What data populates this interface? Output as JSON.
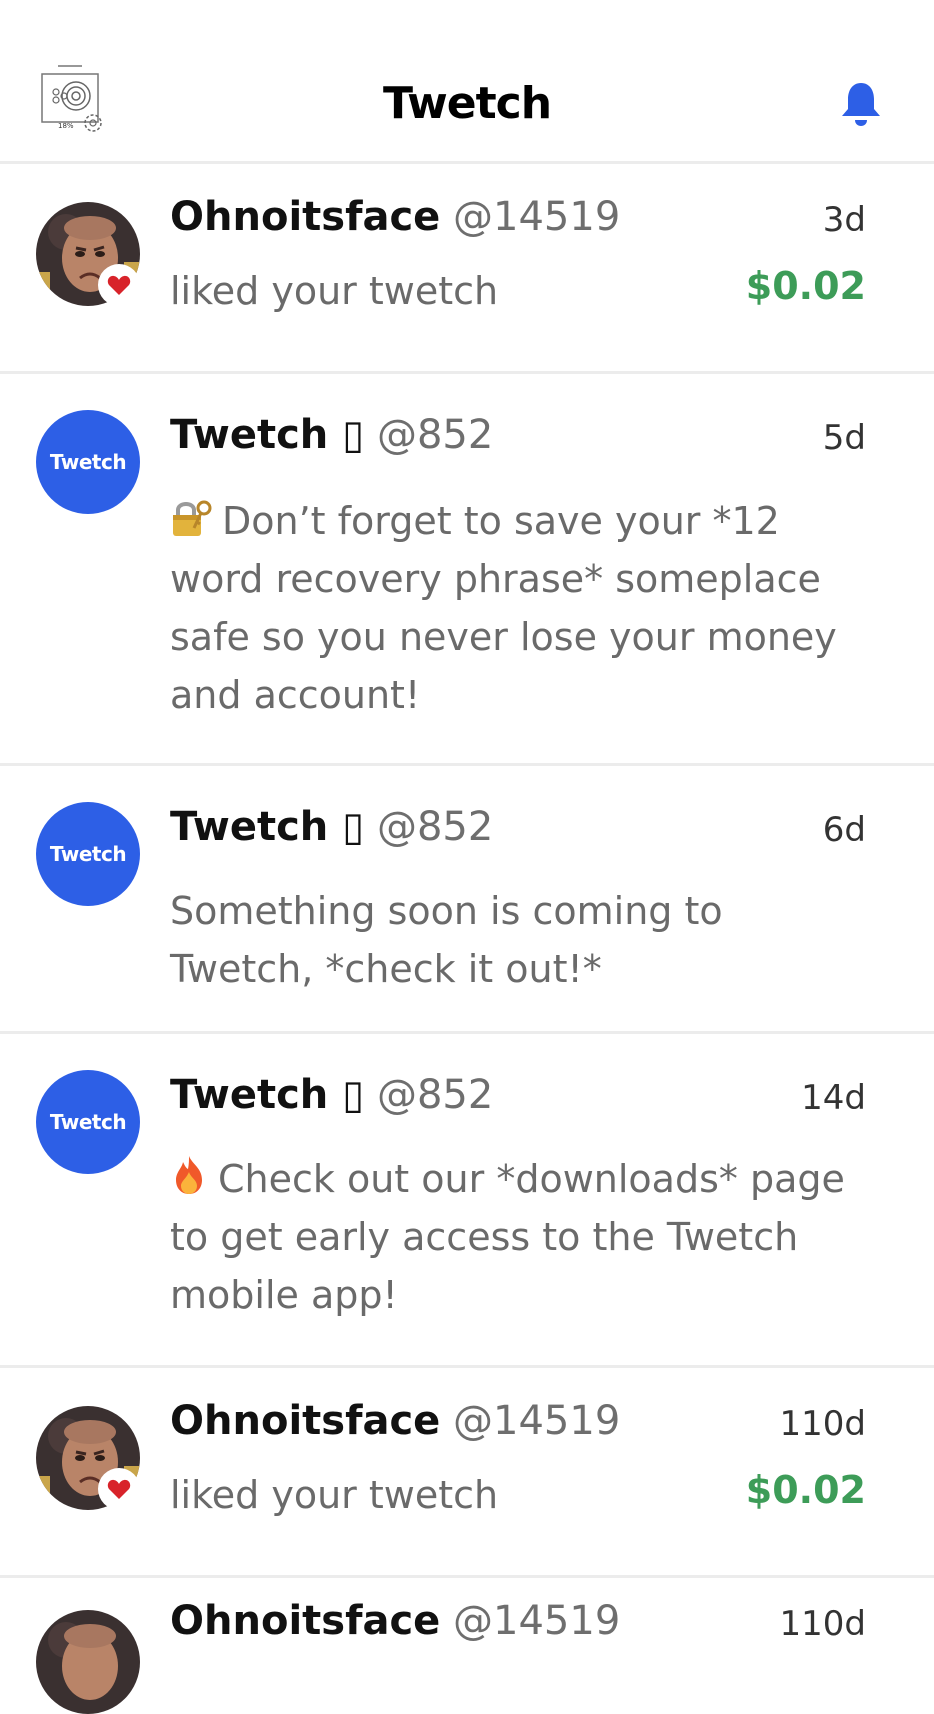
{
  "header": {
    "title": "Twetch",
    "settings_icon": "settings-gear-icon",
    "settings_percent": "18%",
    "bell_icon": "bell-icon",
    "accent_color": "#2d5fe6"
  },
  "notifications": [
    {
      "author": "Ohnoitsface",
      "handle": "@14519",
      "time": "3d",
      "text": "liked your twetch",
      "amount": "$0.02",
      "avatar_icon": "user-avatar-photo",
      "badge_icon": "heart-icon"
    },
    {
      "author": "Twetch ▯",
      "handle": "@852",
      "time": "5d",
      "avatar_label": "Twetch",
      "emoji_icon": "lock-key-emoji-icon",
      "text": "Don’t forget to save your *12 word recovery phrase* someplace safe so you never lose your money and account!"
    },
    {
      "author": "Twetch ▯",
      "handle": "@852",
      "time": "6d",
      "avatar_label": "Twetch",
      "text": "Something soon is coming to Twetch, *check it out!*"
    },
    {
      "author": "Twetch ▯",
      "handle": "@852",
      "time": "14d",
      "avatar_label": "Twetch",
      "emoji_icon": "fire-emoji-icon",
      "text": "Check out our *downloads* page to get early access to the Twetch mobile app!"
    },
    {
      "author": "Ohnoitsface",
      "handle": "@14519",
      "time": "110d",
      "text": "liked your twetch",
      "amount": "$0.02",
      "avatar_icon": "user-avatar-photo",
      "badge_icon": "heart-icon"
    },
    {
      "author": "Ohnoitsface",
      "handle": "@14519",
      "time": "110d",
      "avatar_icon": "user-avatar-photo"
    }
  ],
  "colors": {
    "amount_green": "#3d9c58",
    "brand_blue": "#2d5fe6",
    "heart_red": "#d8232a"
  }
}
